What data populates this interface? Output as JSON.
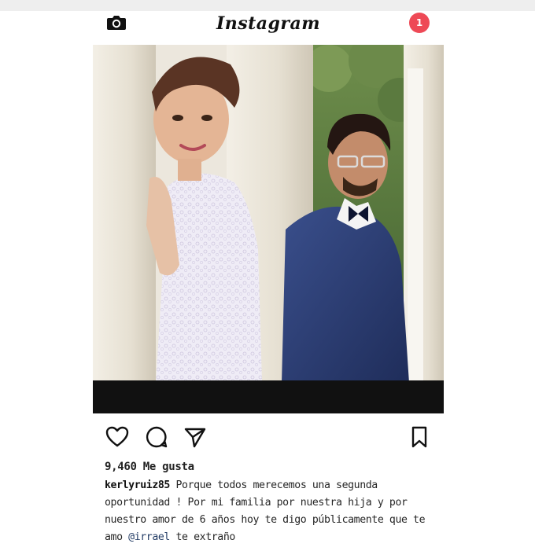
{
  "app": {
    "title": "Instagram",
    "notification_count": "1"
  },
  "post": {
    "likes": "9,460 Me gusta",
    "caption": {
      "username": "kerlyruiz85",
      "text_before_mention": "Porque todos merecemos una segunda oportunidad ! Por mi familia por nuestra hija y por nuestro amor de 6 años hoy te digo públicamente que te amo",
      "mention": "@irrael",
      "text_after_mention": "te extraño"
    }
  },
  "icons": {
    "header_left": "camera-icon",
    "like": "heart-icon",
    "comment": "comment-icon",
    "share": "send-icon",
    "save": "bookmark-icon"
  },
  "colors": {
    "notification_badge": "#ee4956",
    "mention": "#243d66"
  }
}
